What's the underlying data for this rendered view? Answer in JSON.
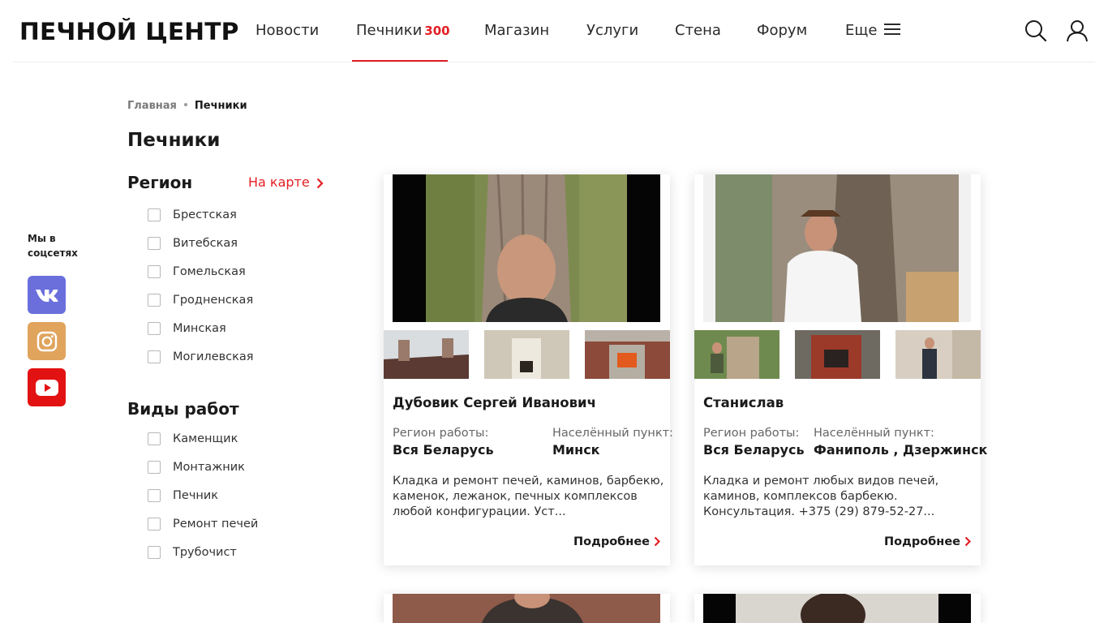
{
  "site": {
    "logo": "ПЕЧНОЙ ЦЕНТР"
  },
  "nav": {
    "news": "Новости",
    "stovemakers": "Печники",
    "stovemakers_count": "300",
    "shop": "Магазин",
    "services": "Услуги",
    "wall": "Стена",
    "forum": "Форум",
    "more": "Еще"
  },
  "icons": {
    "search": "search-icon",
    "user": "user-icon",
    "menu": "burger-icon"
  },
  "social": {
    "title": "Мы в соцсетях",
    "items": [
      {
        "name": "vk",
        "color": "#6a6fdc"
      },
      {
        "name": "instagram",
        "color": "#e0a45d"
      },
      {
        "name": "youtube",
        "color": "#e31212"
      }
    ]
  },
  "breadcrumb": {
    "home": "Главная",
    "current": "Печники"
  },
  "page": {
    "title": "Печники"
  },
  "filters": {
    "region": {
      "title": "Регион",
      "map_link": "На карте",
      "options": [
        "Брестская",
        "Витебская",
        "Гомельская",
        "Гродненская",
        "Минская",
        "Могилевская"
      ]
    },
    "work_types": {
      "title": "Виды работ",
      "options": [
        "Каменщик",
        "Монтажник",
        "Печник",
        "Ремонт печей",
        "Трубочист"
      ]
    }
  },
  "cards": [
    {
      "name": "Дубовик Сергей Иванович",
      "region_label": "Регион работы:",
      "region_value": "Вся Беларусь",
      "locality_label": "Населённый пункт:",
      "locality_value": "Минск",
      "description": "Кладка и ремонт печей, каминов, барбекю, каменок, лежанок, печных комплексов любой конфигурации. Уст...",
      "more": "Подробнее"
    },
    {
      "name": "Станислав",
      "region_label": "Регион работы:",
      "region_value": "Вся Беларусь",
      "locality_label": "Населённый пункт:",
      "locality_value": "Фаниполь , Дзержинск",
      "description": "Кладка и ремонт любых видов печей, каминов, комплексов барбекю. Консультация. +375 (29) 879-52-27...",
      "more": "Подробнее"
    }
  ],
  "colors": {
    "accent": "#e31e24"
  }
}
